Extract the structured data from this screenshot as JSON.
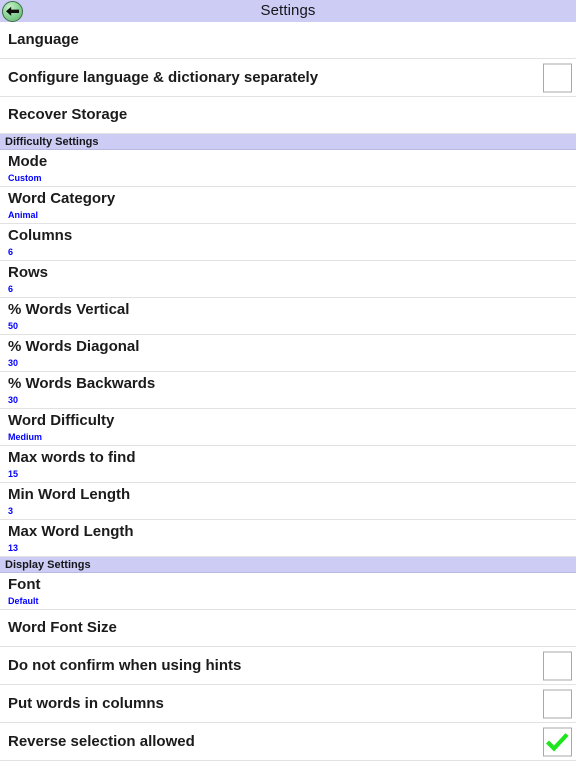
{
  "titlebar": {
    "title": "Settings",
    "back_icon": "back-arrow-icon"
  },
  "colors": {
    "header_bg": "#ccccf5",
    "subtitle": "#0000ff",
    "check": "#1de61d",
    "back_button": "#8fd79a"
  },
  "sections": [
    {
      "header": null,
      "rows": [
        {
          "title": "Language",
          "sub": null,
          "checkbox": null
        },
        {
          "title": "Configure language & dictionary separately",
          "sub": null,
          "checkbox": false
        },
        {
          "title": "Recover Storage",
          "sub": null,
          "checkbox": null
        }
      ]
    },
    {
      "header": "Difficulty Settings",
      "rows": [
        {
          "title": "Mode",
          "sub": "Custom",
          "checkbox": null
        },
        {
          "title": "Word Category",
          "sub": "Animal",
          "checkbox": null
        },
        {
          "title": "Columns",
          "sub": "6",
          "checkbox": null
        },
        {
          "title": "Rows",
          "sub": "6",
          "checkbox": null
        },
        {
          "title": "% Words Vertical",
          "sub": "50",
          "checkbox": null
        },
        {
          "title": "% Words Diagonal",
          "sub": "30",
          "checkbox": null
        },
        {
          "title": "% Words Backwards",
          "sub": "30",
          "checkbox": null
        },
        {
          "title": "Word Difficulty",
          "sub": "Medium",
          "checkbox": null
        },
        {
          "title": "Max words to find",
          "sub": "15",
          "checkbox": null
        },
        {
          "title": "Min Word Length",
          "sub": "3",
          "checkbox": null
        },
        {
          "title": "Max Word Length",
          "sub": "13",
          "checkbox": null
        }
      ]
    },
    {
      "header": "Display Settings",
      "rows": [
        {
          "title": "Font",
          "sub": "Default",
          "checkbox": null
        },
        {
          "title": "Word Font Size",
          "sub": null,
          "checkbox": null
        },
        {
          "title": "Do not confirm when using hints",
          "sub": null,
          "checkbox": false
        },
        {
          "title": "Put words in columns",
          "sub": null,
          "checkbox": false
        },
        {
          "title": "Reverse selection allowed",
          "sub": null,
          "checkbox": true
        }
      ]
    }
  ]
}
